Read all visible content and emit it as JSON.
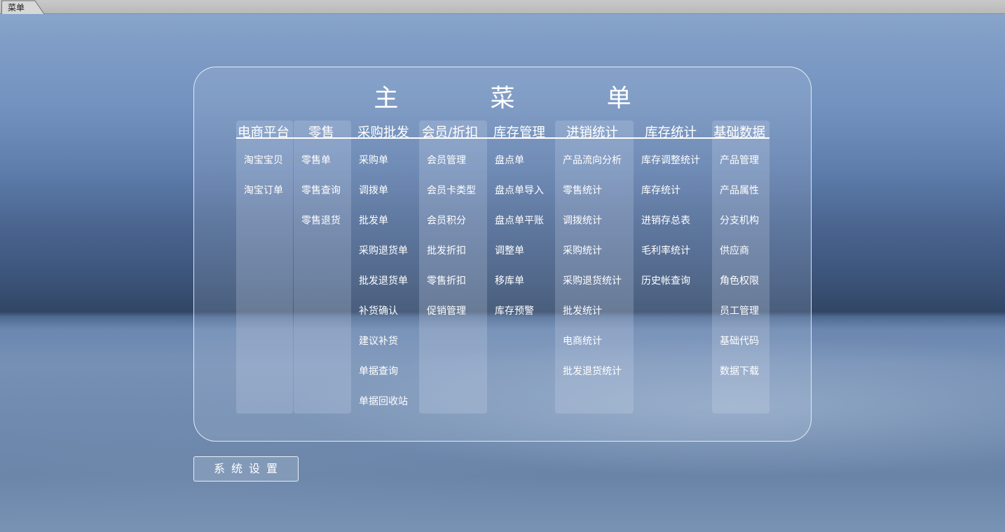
{
  "tab": {
    "label": "菜单"
  },
  "title": "主 菜 单",
  "columns": [
    {
      "header": "电商平台",
      "items": [
        "淘宝宝贝",
        "淘宝订单"
      ]
    },
    {
      "header": "零售",
      "items": [
        "零售单",
        "零售查询",
        "零售退货"
      ]
    },
    {
      "header": "采购批发",
      "items": [
        "采购单",
        "调拨单",
        "批发单",
        "采购退货单",
        "批发退货单",
        "补货确认",
        "建议补货",
        "单据查询",
        "单据回收站"
      ]
    },
    {
      "header": "会员/折扣",
      "items": [
        "会员管理",
        "会员卡类型",
        "会员积分",
        "批发折扣",
        "零售折扣",
        "促销管理"
      ]
    },
    {
      "header": "库存管理",
      "items": [
        "盘点单",
        "盘点单导入",
        "盘点单平账",
        "调整单",
        "移库单",
        "库存预警"
      ]
    },
    {
      "header": "进销统计",
      "items": [
        "产品流向分析",
        "零售统计",
        "调拨统计",
        "采购统计",
        "采购退货统计",
        "批发统计",
        "电商统计",
        "批发退货统计"
      ]
    },
    {
      "header": "库存统计",
      "items": [
        "库存调整统计",
        "库存统计",
        "进销存总表",
        "毛利率统计",
        "历史帐查询"
      ]
    },
    {
      "header": "基础数据",
      "items": [
        "产品管理",
        "产品属性",
        "分支机构",
        "供应商",
        "角色权限",
        "员工管理",
        "基础代码",
        "数据下载"
      ]
    }
  ],
  "system_settings": "系统设置",
  "colors": {
    "text": "#ffffff",
    "panel_border": "#ebf2fa",
    "tab_bg": "#c0c0c0"
  }
}
